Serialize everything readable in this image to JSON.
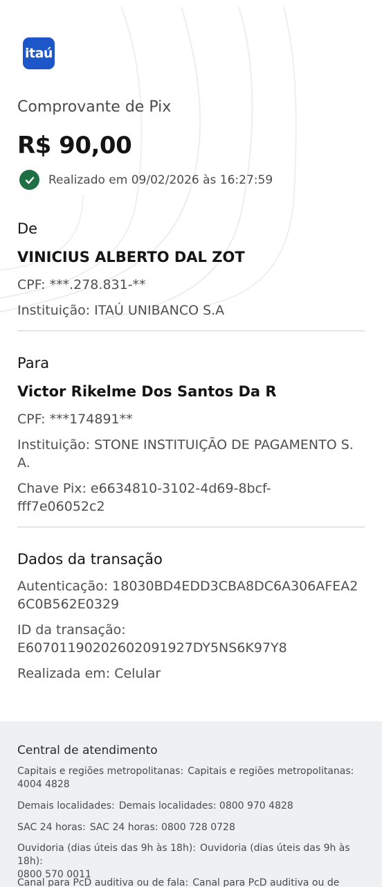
{
  "brand": {
    "logo_text": "itaú",
    "color": "#1c56c9"
  },
  "receipt": {
    "title": "Comprovante de Pix",
    "amount": "R$ 90,00",
    "status_text": "Realizado em 09/02/2026 às 16:27:59",
    "status_color": "#1f6f45"
  },
  "from": {
    "heading": "De",
    "name": "VINICIUS ALBERTO DAL ZOT",
    "cpf_label": "CPF:",
    "cpf": "***.278.831-**",
    "inst_label": "Instituição:",
    "inst": "ITAÚ UNIBANCO S.A"
  },
  "to": {
    "heading": "Para",
    "name": "Victor Rikelme Dos Santos Da R",
    "cpf_label": "CPF:",
    "cpf": "***174891**",
    "inst_label": "Instituição:",
    "inst_line1": "STONE INSTITUIÇÃO DE PAGAMENTO S.",
    "inst_line2": "A.",
    "key_label": "Chave Pix:",
    "key_line1": "e6634810-3102-4d69-8bcf-",
    "key_line2": "fff7e06052c2"
  },
  "transaction": {
    "heading": "Dados da transação",
    "auth_label": "Autenticação:",
    "auth_line1": "18030BD4EDD3CBA8DC6A306AFEA2",
    "auth_line2": "6C0B562E0329",
    "id_label": "ID da transação:",
    "id_value": "E60701190202602091927DY5NS6K97Y8",
    "done_label": "Realizada em:",
    "done_value": "Celular"
  },
  "footer": {
    "title": "Central de atendimento",
    "items": [
      {
        "label": "Capitais e regiões metropolitanas:",
        "line1": "Capitais e regiões metropolitanas:",
        "line2": "4004 4828"
      },
      {
        "label": "Demais localidades:",
        "line1": "Demais localidades: 0800 970 4828"
      },
      {
        "label": "SAC 24 horas:",
        "line1": "SAC 24 horas: 0800 728 0728"
      },
      {
        "label": "Ouvidoria (dias úteis das 9h às 18h):",
        "line1": "Ouvidoria (dias úteis das 9h às 18h):",
        "line2": "0800 570 0011"
      },
      {
        "label": "Canal para PcD auditiva ou de fala:",
        "line1": "Canal para PcD auditiva ou de fala:"
      }
    ]
  }
}
